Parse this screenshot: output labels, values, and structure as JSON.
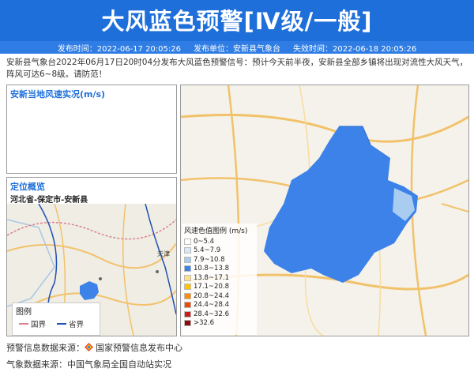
{
  "header": {
    "title": "大风蓝色预警[Ⅳ级/一般]",
    "issue_time": "发布时间：2022-06-17 20:05:26",
    "issuer": "发布单位：安新县气象台",
    "expire_time": "失效时间：2022-06-18 20:05:26"
  },
  "description": "安新县气象台2022年06月17日20时04分发布大风蓝色预警信号：预计今天前半夜，安新县全部乡镇将出现对流性大风天气，阵风可达6~8级。请防范！",
  "wind_panel": {
    "title": "安新当地风速实况(m/s)"
  },
  "location_panel": {
    "title": "定位概览",
    "path": "河北省-保定市-安新县",
    "map_label": "天津",
    "legend": {
      "title": "图例",
      "items": [
        {
          "label": "国界",
          "color": "#d9838f"
        },
        {
          "label": "省界",
          "color": "#1e4fb5"
        }
      ]
    }
  },
  "main_map": {
    "warning_color": "#3d82e8",
    "speed_legend": {
      "title": "风速色值图例 (m/s)",
      "items": [
        {
          "label": "0~5.4",
          "color": "#ffffff"
        },
        {
          "label": "5.4~7.9",
          "color": "#d7e9f7"
        },
        {
          "label": "7.9~10.8",
          "color": "#a8cdf0"
        },
        {
          "label": "10.8~13.8",
          "color": "#3d82e8"
        },
        {
          "label": "13.8~17.1",
          "color": "#ffe08a"
        },
        {
          "label": "17.1~20.8",
          "color": "#ffc400"
        },
        {
          "label": "20.8~24.4",
          "color": "#ff8c00"
        },
        {
          "label": "24.4~28.4",
          "color": "#f04a00"
        },
        {
          "label": "28.4~32.6",
          "color": "#c81d1d"
        },
        {
          "label": ">32.6",
          "color": "#8b0a0a"
        }
      ]
    }
  },
  "footer": {
    "warning_source": "预警信息数据来源：",
    "warning_source_name": "国家预警信息发布中心",
    "weather_source": "气象数据来源：中国气象局全国自动站实况"
  }
}
